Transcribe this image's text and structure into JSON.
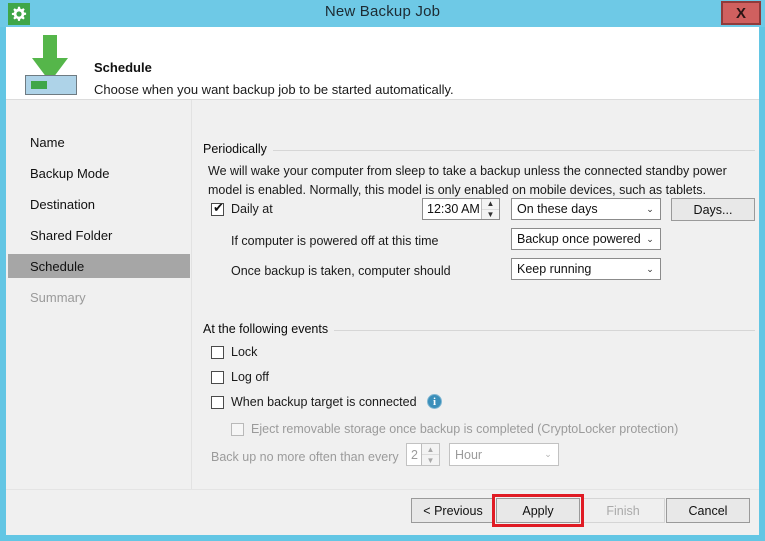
{
  "window": {
    "title": "New Backup Job",
    "app_icon": "gear-icon",
    "close_label": "X"
  },
  "header": {
    "icon": "green-down-arrow-to-drive-icon",
    "title": "Schedule",
    "subtitle": "Choose when you want backup job to be started automatically."
  },
  "sidebar": {
    "items": [
      {
        "label": "Name",
        "state": "normal"
      },
      {
        "label": "Backup Mode",
        "state": "normal"
      },
      {
        "label": "Destination",
        "state": "normal"
      },
      {
        "label": "Shared Folder",
        "state": "normal"
      },
      {
        "label": "Schedule",
        "state": "active"
      },
      {
        "label": "Summary",
        "state": "disabled"
      }
    ]
  },
  "periodically": {
    "group_title": "Periodically",
    "description": "We will wake your computer from sleep to take a backup unless the connected standby power model is enabled. Normally, this model is only enabled on mobile devices, such as tablets.",
    "daily_at": {
      "label": "Daily at",
      "checked": true,
      "time_value": "12:30 AM",
      "days_mode_value": "On these days",
      "days_button_label": "Days..."
    },
    "powered_off": {
      "label": "If computer is powered off at this time",
      "value": "Backup once powered c"
    },
    "after_backup": {
      "label": "Once backup is taken, computer should",
      "value": "Keep running"
    }
  },
  "events": {
    "group_title": "At the following events",
    "checkboxes": [
      {
        "label": "Lock",
        "checked": false,
        "disabled": false
      },
      {
        "label": "Log off",
        "checked": false,
        "disabled": false
      },
      {
        "label": "When backup target is connected",
        "checked": false,
        "disabled": false,
        "info": "i"
      },
      {
        "label": "Eject removable storage once backup is completed (CryptoLocker protection)",
        "checked": false,
        "disabled": true
      }
    ],
    "throttle": {
      "label": "Back up no more often than every",
      "amount": "2",
      "unit": "Hour",
      "disabled": true
    }
  },
  "footer": {
    "previous_label": "< Previous",
    "apply_label": "Apply",
    "finish_label": "Finish",
    "cancel_label": "Cancel",
    "finish_disabled": true,
    "highlight_color": "#e01b24"
  },
  "spinner_glyphs": {
    "up": "▲",
    "down": "▼"
  },
  "combo_glyph": "⌄",
  "check_glyph": "✔"
}
